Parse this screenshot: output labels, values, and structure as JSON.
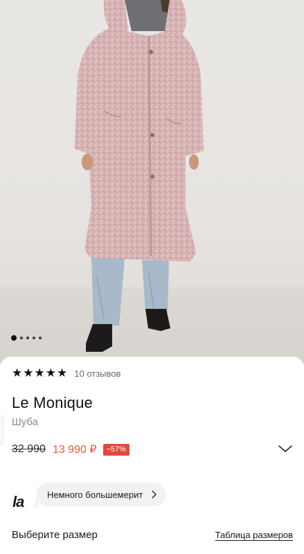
{
  "gallery": {
    "slide_count": 5,
    "active_index": 0
  },
  "product": {
    "rating": 5,
    "reviews_label": "10 отзывов",
    "brand": "Le Monique",
    "type": "Шуба",
    "old_price": "32 990",
    "new_price": "13 990 ₽",
    "discount": "−57%"
  },
  "fit": {
    "logo": "la",
    "bubble_text": "Немного большемерит"
  },
  "size": {
    "label": "Выберите размер",
    "table_link": "Таблица размеров"
  },
  "colors": {
    "price_accent": "#e25a3c",
    "discount_badge": "#e04a3b",
    "coat": "#d7b3b4"
  },
  "icons": {
    "rating": "star-icon",
    "expand": "chevron-down-icon",
    "bubble": "chevron-right-icon"
  }
}
